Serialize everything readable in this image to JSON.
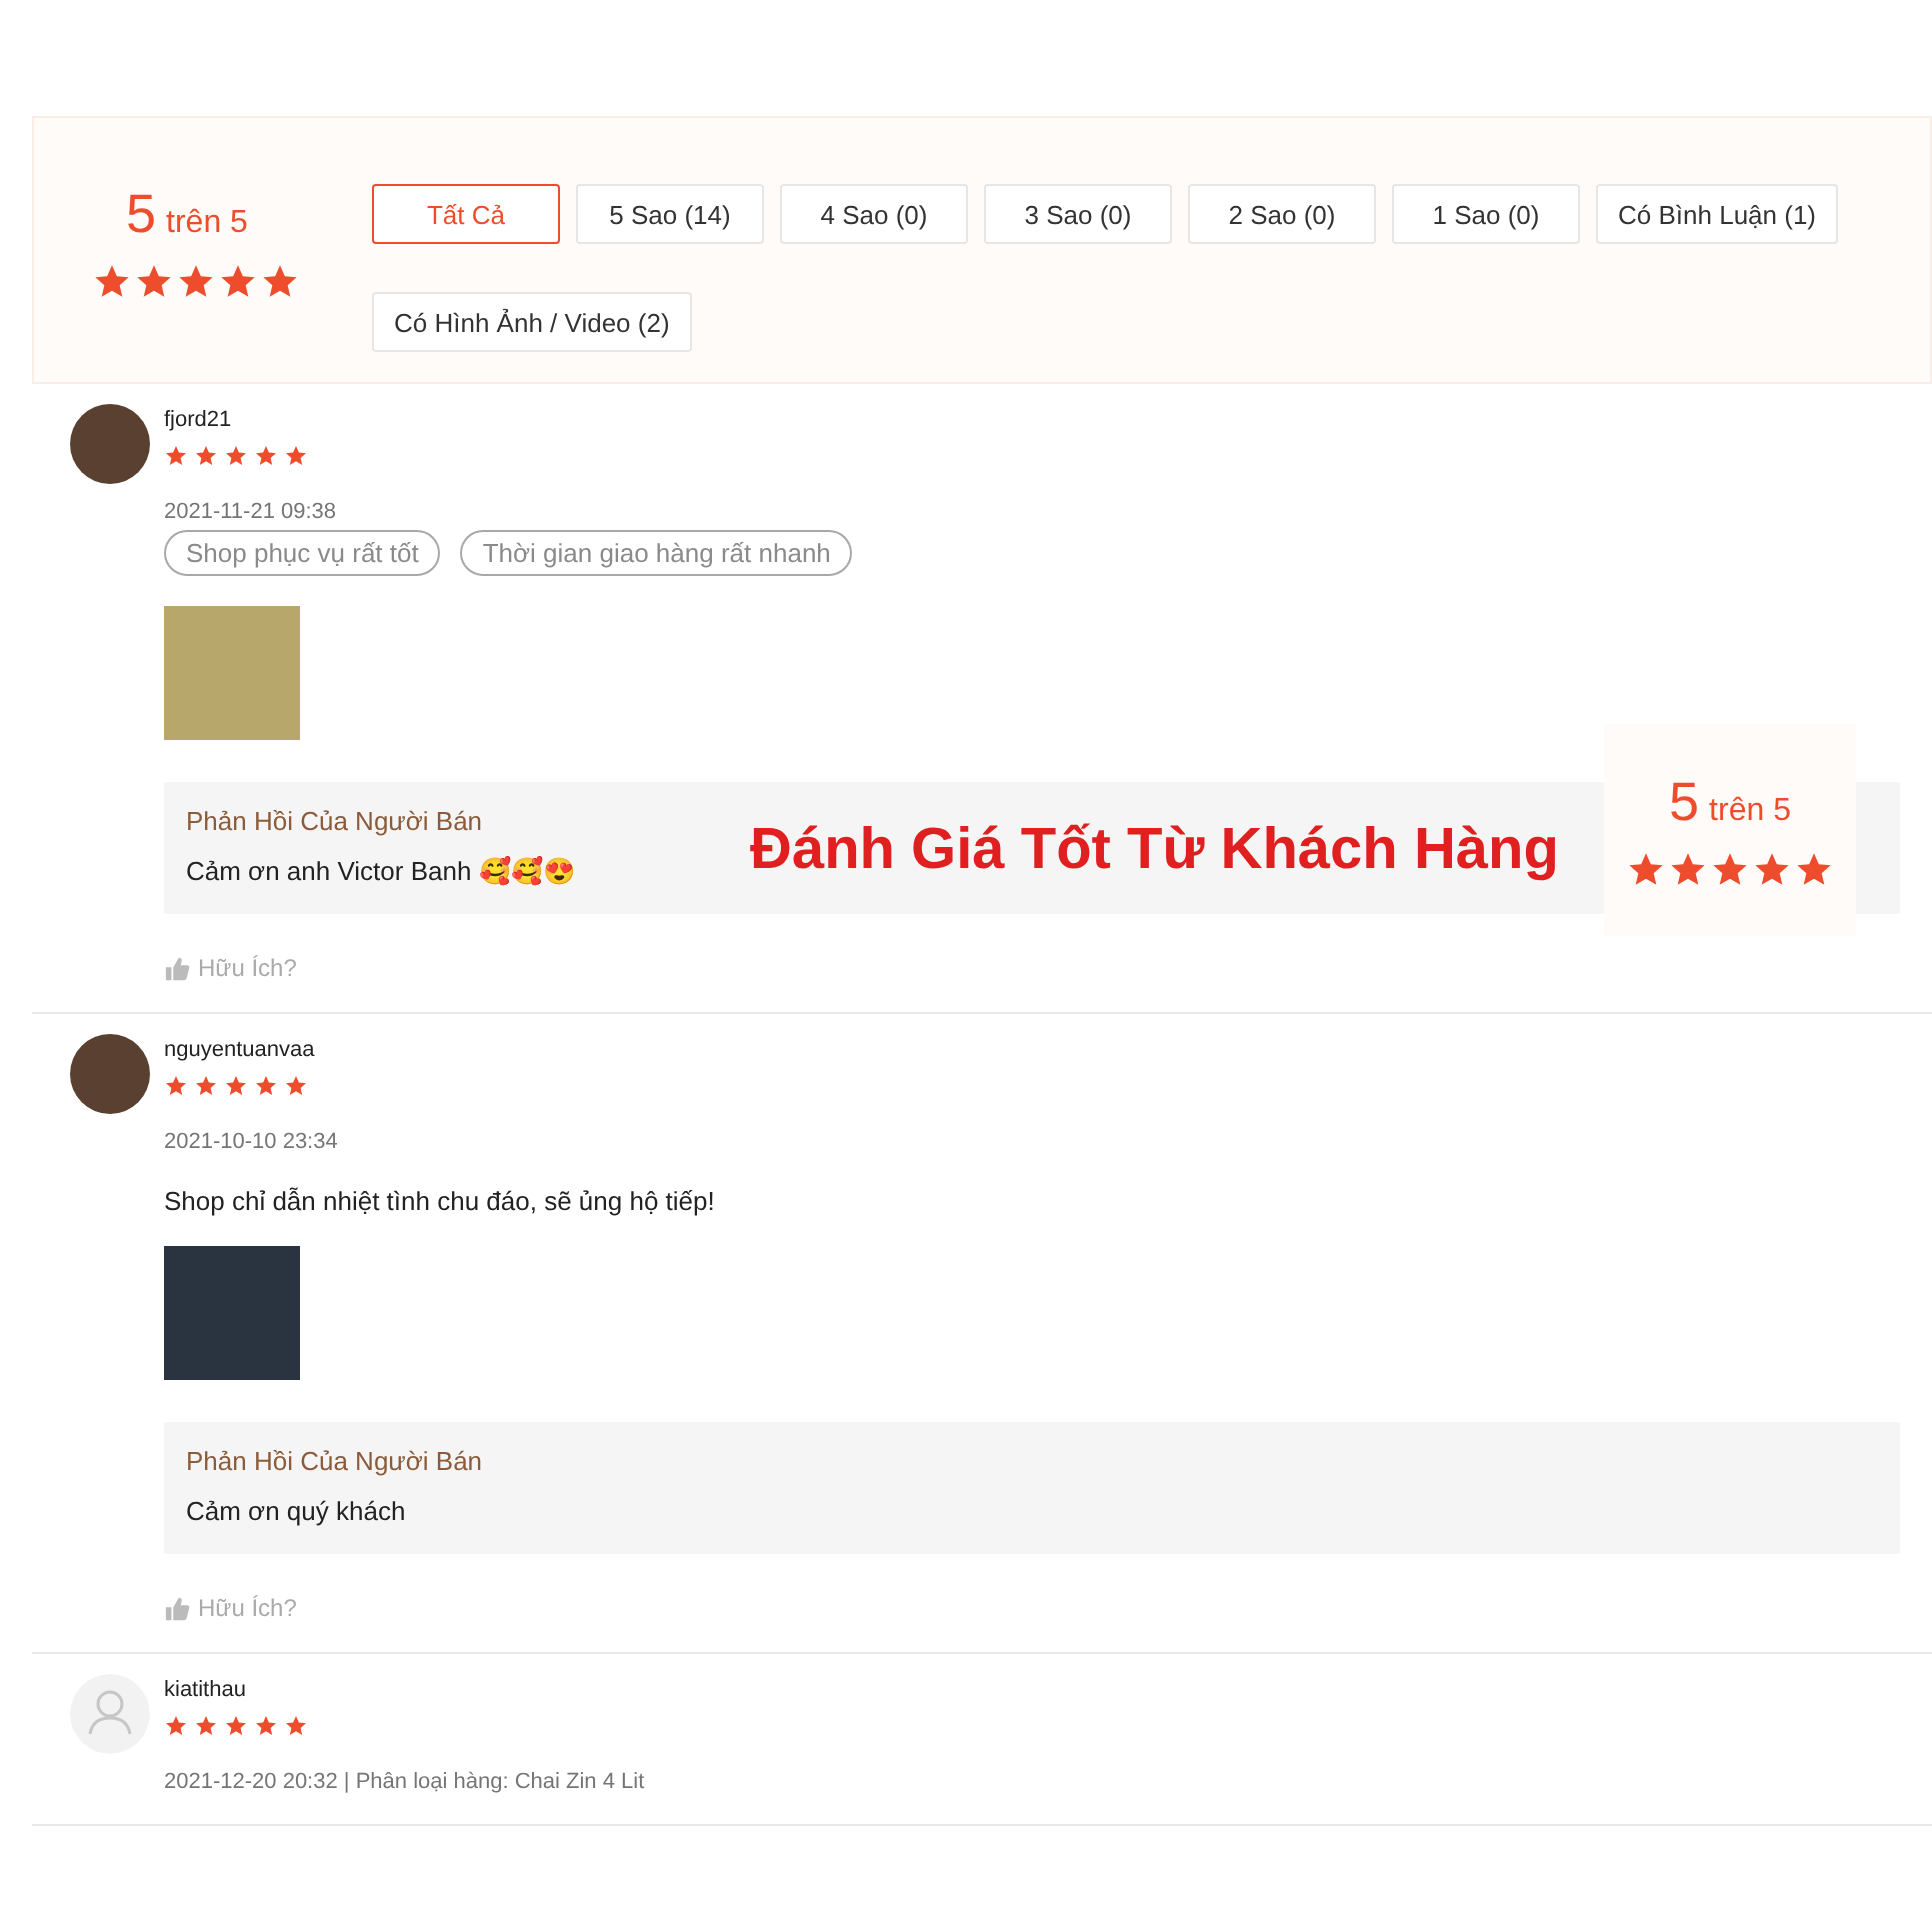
{
  "summary": {
    "score": "5",
    "out_of": "trên 5",
    "stars": 5
  },
  "filters": [
    {
      "label": "Tất Cả",
      "selected": true
    },
    {
      "label": "5 Sao (14)",
      "selected": false
    },
    {
      "label": "4 Sao (0)",
      "selected": false
    },
    {
      "label": "3 Sao (0)",
      "selected": false
    },
    {
      "label": "2 Sao (0)",
      "selected": false
    },
    {
      "label": "1 Sao (0)",
      "selected": false
    },
    {
      "label": "Có Bình Luận (1)",
      "selected": false
    },
    {
      "label": "Có Hình Ảnh / Video (2)",
      "selected": false
    }
  ],
  "reviews": [
    {
      "kind": "photo",
      "username": "fjord21",
      "stars": 5,
      "meta": "2021-11-21 09:38",
      "tags": [
        "Shop phục vụ rất tốt",
        "Thời gian giao hàng rất nhanh"
      ],
      "has_photo": true,
      "reply": {
        "title": "Phản Hồi Của Người Bán",
        "text": "Cảm ơn anh Victor Banh 🥰🥰😍"
      },
      "helpful": "Hữu Ích?"
    },
    {
      "kind": "photo",
      "username": "nguyentuanvaa",
      "stars": 5,
      "meta": "2021-10-10 23:34",
      "comment": "Shop chỉ dẫn nhiệt tình chu đáo, sẽ ủng hộ tiếp!",
      "has_photo": true,
      "reply": {
        "title": "Phản Hồi Của Người Bán",
        "text": "Cảm ơn quý khách"
      },
      "helpful": "Hữu Ích?"
    },
    {
      "kind": "default",
      "username": "kiatithau",
      "stars": 5,
      "meta": "2021-12-20 20:32 | Phân loại hàng: Chai Zin 4 Lit"
    }
  ],
  "banner": {
    "title": "Đánh Giá Tốt Từ Khách Hàng",
    "score": "5",
    "out_of": "trên 5",
    "stars": 5
  }
}
